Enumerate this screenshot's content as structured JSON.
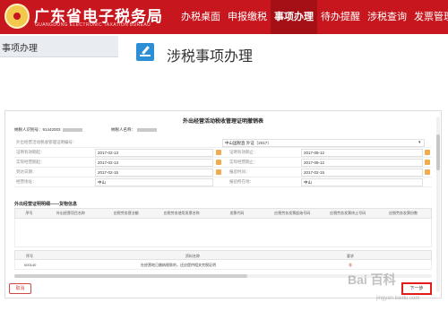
{
  "header": {
    "brand_title": "广东省电子税务局",
    "brand_subtitle": "GUANGDONG ELECTRONIC TAXATION BUREAU",
    "nav": [
      "办税桌面",
      "申报缴税",
      "事项办理",
      "待办提醒",
      "涉税查询",
      "发票管理"
    ],
    "active_nav": "事项办理"
  },
  "sidebar": {
    "tab_label": "事项办理"
  },
  "page": {
    "title": "涉税事项办理"
  },
  "form": {
    "title": "外出经营活动税收管理证明撤销表",
    "taxpayer_id_label": "纳税人识别号：91442003",
    "taxpayer_name_label": "纳税人名称：",
    "rows": [
      {
        "l1": "外出经营活动税收管理证明编号：",
        "v1": "",
        "l2": "",
        "v2": "中山国税直 外证〔2017〕"
      },
      {
        "l1": "证明有效期起：",
        "v1": "2017-02-13",
        "l2": "证明有效期止：",
        "v2": "2017-08-12"
      },
      {
        "l1": "实际经营期起：",
        "v1": "2017-02-13",
        "l2": "实际经营期止：",
        "v2": "2017-08-12"
      },
      {
        "l1": "到达日期：",
        "v1": "2017-02-15",
        "l2": "报验时间：",
        "v2": "2017-02-15"
      },
      {
        "l1": "经营地址：",
        "v1": "中山",
        "l2": "报验所在地：",
        "v2": "中山"
      }
    ],
    "section_title": "外出经营证明明细——货物信息",
    "goods_headers": [
      "序号",
      "外出经营项目名称",
      "应税劳务营业额",
      "应税劳务使用发票名称",
      "发票代码",
      "应税劳务发票起始号码",
      "应税劳务发票终止号码",
      "应税劳务发票份数"
    ],
    "attach_headers": {
      "index": "序号",
      "name": "资料名称",
      "required": "要求"
    },
    "attach_row": {
      "index": "000140",
      "name": "在经营地已缴纳税款的，还应提供相关完税证明",
      "required": "非"
    }
  },
  "buttons": {
    "cancel": "取消",
    "next": "下一步"
  },
  "watermark": {
    "main": "Bai 百科",
    "sub": "jingyan.baidu.com"
  },
  "colors": {
    "header_red": "#c8161e",
    "accent_blue": "#2c8fd6",
    "highlight_red": "#e21b1b"
  }
}
